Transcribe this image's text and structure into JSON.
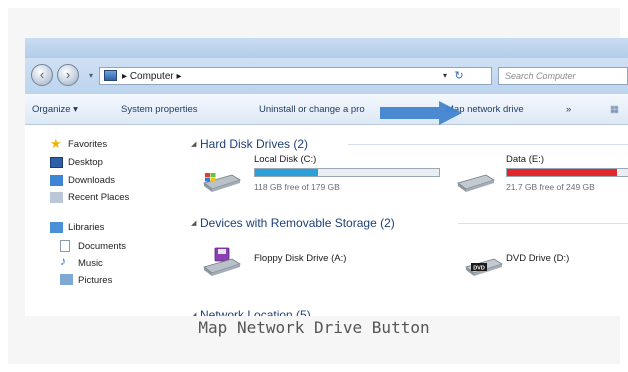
{
  "address_bar": {
    "crumb": "Computer",
    "search_placeholder": "Search Computer"
  },
  "command_bar": {
    "organize": "Organize ▾",
    "system_properties": "System properties",
    "uninstall": "Uninstall or change a pro",
    "map_network_drive": "Map network drive",
    "more": "»"
  },
  "sidebar": {
    "favorites": "Favorites",
    "desktop": "Desktop",
    "downloads": "Downloads",
    "recent_places": "Recent Places",
    "libraries": "Libraries",
    "documents": "Documents",
    "music": "Music",
    "pictures": "Pictures"
  },
  "groups": {
    "hard_disk": "Hard Disk Drives (2)",
    "removable": "Devices with Removable Storage (2)",
    "network": "Network Location (5)"
  },
  "drives": [
    {
      "name": "Local Disk (C:)",
      "free": "118 GB free of 179 GB",
      "used_fraction": 0.34,
      "bar_color": "#2aa0d8"
    },
    {
      "name": "Data (E:)",
      "free": "21.7 GB free of 249 GB",
      "used_fraction": 0.91,
      "bar_color": "#e2262b"
    }
  ],
  "removable": [
    {
      "name": "Floppy Disk Drive (A:)"
    },
    {
      "name": "DVD Drive (D:)",
      "badge": "DVD"
    }
  ],
  "caption": "Map Network Drive Button"
}
